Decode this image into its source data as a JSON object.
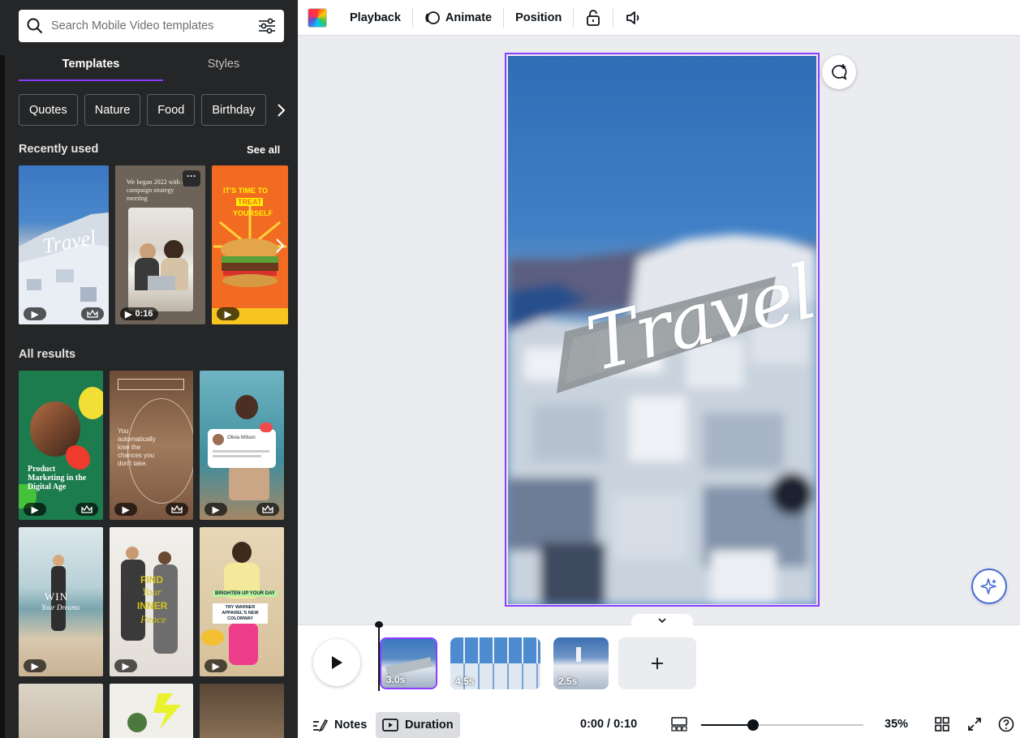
{
  "left_panel": {
    "search_placeholder": "Search Mobile Video templates",
    "tabs": [
      {
        "label": "Templates",
        "active": true
      },
      {
        "label": "Styles",
        "active": false
      }
    ],
    "chips": [
      "Quotes",
      "Nature",
      "Food",
      "Birthday"
    ],
    "recently_used": {
      "heading": "Recently used",
      "see_all": "See all",
      "items": [
        {
          "title_art": "Travel",
          "premium": true
        },
        {
          "caption": "We began 2022 with a campaign strategy meeting",
          "duration": "0:16"
        },
        {
          "caption_lines": [
            "IT'S TIME TO",
            "TREAT",
            "YOURSELF"
          ]
        }
      ]
    },
    "all_results": {
      "heading": "All results",
      "items": [
        {
          "caption": "Product Marketing in the Digital Age",
          "premium": true
        },
        {
          "caption": "You automatically lose the chances you don't take.",
          "premium": true
        },
        {
          "caption": "Olivia Wilson",
          "premium": true
        },
        {
          "caption": "WIN",
          "caption2": "Your Dreams"
        },
        {
          "caption": "FIND",
          "caption2": "Your",
          "caption3": "INNER",
          "caption4": "Peace"
        },
        {
          "caption": "BRIGHTEN UP YOUR DAY",
          "caption2": "TRY WARNER APPAREL'S NEW COLORWAY"
        }
      ]
    }
  },
  "toolbar": {
    "playback": "Playback",
    "animate": "Animate",
    "position": "Position"
  },
  "canvas": {
    "title_text": "Travel"
  },
  "timeline": {
    "clips": [
      {
        "duration": "3.0s",
        "selected": true
      },
      {
        "duration": "4.5s",
        "selected": false
      },
      {
        "duration": "2.5s",
        "selected": false
      }
    ]
  },
  "footer": {
    "notes": "Notes",
    "duration": "Duration",
    "time": "0:00 / 0:10",
    "zoom_level": "35%",
    "zoom_fraction": 0.32
  },
  "colors": {
    "accent": "#8b3dff",
    "panel_bg": "#252627"
  }
}
